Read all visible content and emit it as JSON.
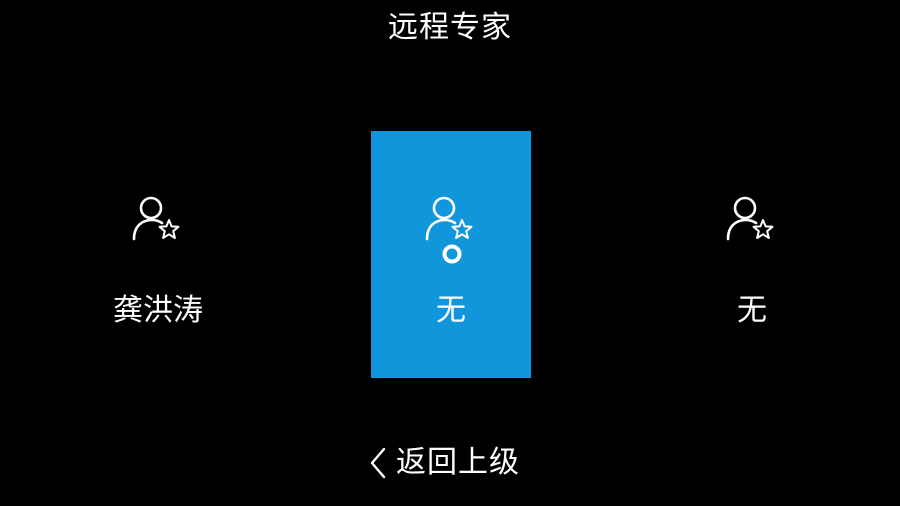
{
  "header": {
    "title": "远程专家"
  },
  "experts": [
    {
      "name": "龚洪涛",
      "icon": "user-star-icon",
      "selected": false
    },
    {
      "name": "无",
      "icon": "user-star-icon",
      "selected": true
    },
    {
      "name": "无",
      "icon": "user-star-icon",
      "selected": false
    }
  ],
  "footer": {
    "back_label": "返回上级",
    "back_icon": "chevron-left-icon"
  },
  "colors": {
    "background": "#000000",
    "selected_card": "#1296db",
    "text": "#ffffff"
  }
}
